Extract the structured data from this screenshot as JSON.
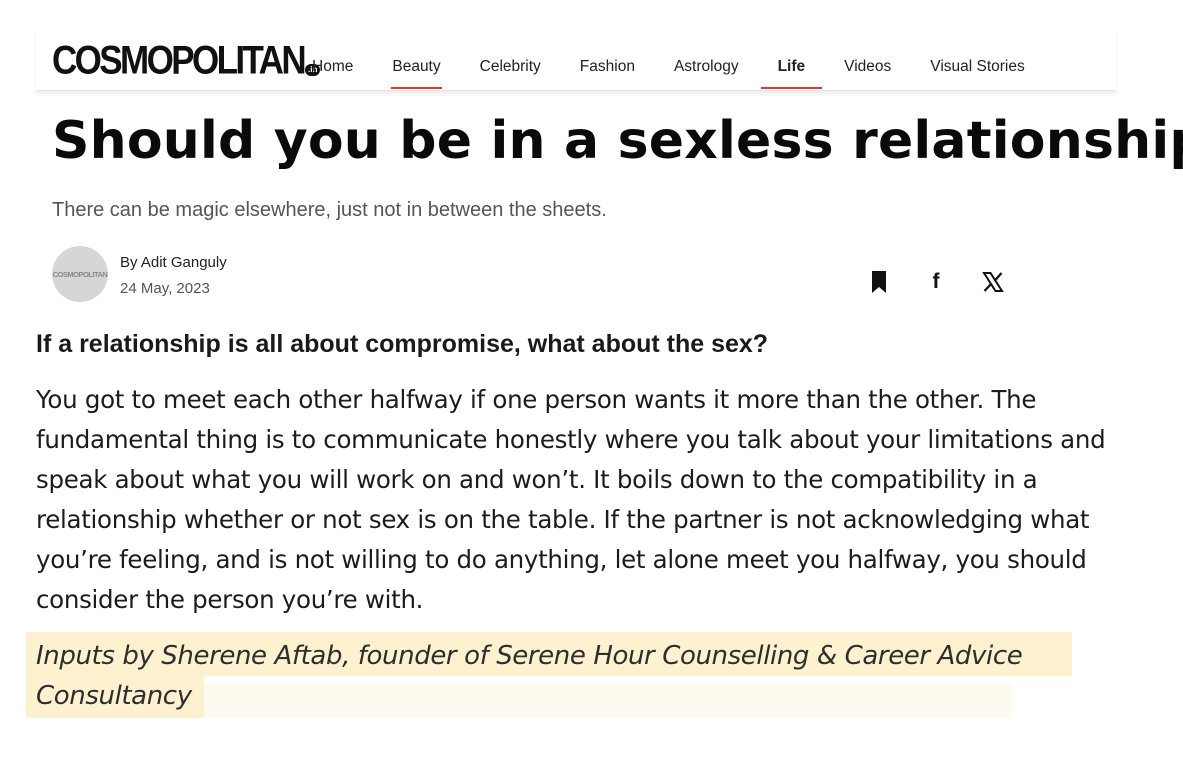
{
  "header": {
    "logo": "COSMOPOLITAN",
    "logo_badge": ".in",
    "nav": [
      {
        "label": "Home"
      },
      {
        "label": "Beauty"
      },
      {
        "label": "Celebrity"
      },
      {
        "label": "Fashion"
      },
      {
        "label": "Astrology"
      },
      {
        "label": "Life"
      },
      {
        "label": "Videos"
      },
      {
        "label": "Visual Stories"
      }
    ]
  },
  "article": {
    "title": "Should you be in a sexless relationship?",
    "subtitle": "There can be magic elsewhere, just not in between the sheets.",
    "avatar_text": "COSMOPOLITAN",
    "byline": "By Adit Ganguly",
    "date": "24 May, 2023",
    "question": "If a relationship is all about compromise, what about the sex?",
    "body": "You got to meet each other halfway if one person wants it more than the other. The fundamental thing is to communicate honestly where you talk about your limitations and speak about what you will work on and won’t. It boils down to the compatibility in a relationship whether or not sex is on the table. If the partner is not acknowledging what you’re feeling, and is not willing to do anything, let alone meet you halfway, you should consider the person you’re with.",
    "credit": "Inputs by Sherene Aftab, founder of Serene Hour Counselling & Career Advice Consultancy"
  },
  "share": {
    "bookmark_icon": "bookmark-icon",
    "facebook_label": "f",
    "x_label": "𝕏"
  },
  "colors": {
    "accent": "#e0372e",
    "highlight": "#fdf1cf"
  }
}
